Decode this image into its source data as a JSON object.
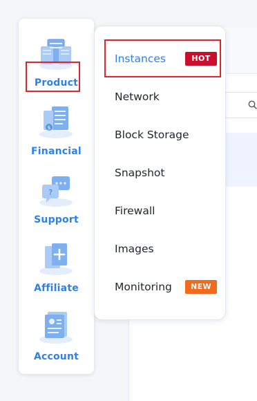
{
  "sidebar": {
    "items": [
      {
        "label": "Product",
        "icon": "server-cluster-icon"
      },
      {
        "label": "Financial",
        "icon": "finance-document-icon"
      },
      {
        "label": "Support",
        "icon": "support-chat-icon"
      },
      {
        "label": "Affiliate",
        "icon": "affiliate-add-icon"
      },
      {
        "label": "Account",
        "icon": "account-profile-icon"
      }
    ]
  },
  "submenu": {
    "items": [
      {
        "label": "Instances",
        "badge": "HOT"
      },
      {
        "label": "Network"
      },
      {
        "label": "Block Storage"
      },
      {
        "label": "Snapshot"
      },
      {
        "label": "Firewall"
      },
      {
        "label": "Images"
      },
      {
        "label": "Monitoring",
        "badge": "NEW"
      }
    ]
  },
  "colors": {
    "accent": "#2f80ed",
    "highlight_box": "#e0242b",
    "hot_badge": "#c8102e",
    "new_badge": "#f26a1b",
    "text": "#222831"
  }
}
